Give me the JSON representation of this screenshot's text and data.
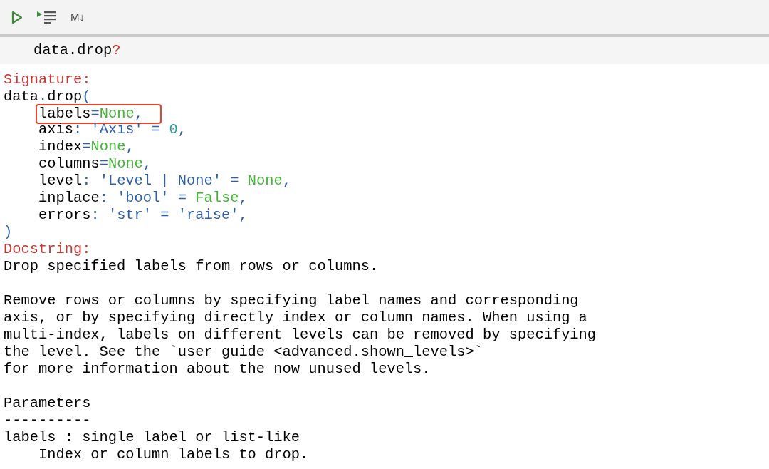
{
  "toolbar": [
    {
      "kind": "run"
    },
    {
      "kind": "run-all"
    },
    {
      "kind": "markdown",
      "label": "M↓"
    }
  ],
  "input": {
    "code": "data.drop",
    "suffix": "?"
  },
  "output": {
    "signature_heading": "Signature:",
    "signature": [
      {
        "indent": false,
        "highlighted": false,
        "tokens": [
          {
            "t": "data",
            "kind": "name"
          },
          {
            "t": ".",
            "kind": "op"
          },
          {
            "t": "drop",
            "kind": "name"
          },
          {
            "t": "(",
            "kind": "op"
          }
        ]
      },
      {
        "indent": true,
        "highlighted": true,
        "tokens": [
          {
            "t": "labels",
            "kind": "name"
          },
          {
            "t": "=",
            "kind": "op"
          },
          {
            "t": "None",
            "kind": "const"
          },
          {
            "t": ",",
            "kind": "op"
          }
        ]
      },
      {
        "indent": true,
        "highlighted": false,
        "tokens": [
          {
            "t": "axis",
            "kind": "name"
          },
          {
            "t": ": 'Axis' = ",
            "kind": "op"
          },
          {
            "t": "0",
            "kind": "num"
          },
          {
            "t": ",",
            "kind": "op"
          }
        ]
      },
      {
        "indent": true,
        "highlighted": false,
        "tokens": [
          {
            "t": "index",
            "kind": "name"
          },
          {
            "t": "=",
            "kind": "op"
          },
          {
            "t": "None",
            "kind": "const"
          },
          {
            "t": ",",
            "kind": "op"
          }
        ]
      },
      {
        "indent": true,
        "highlighted": false,
        "tokens": [
          {
            "t": "columns",
            "kind": "name"
          },
          {
            "t": "=",
            "kind": "op"
          },
          {
            "t": "None",
            "kind": "const"
          },
          {
            "t": ",",
            "kind": "op"
          }
        ]
      },
      {
        "indent": true,
        "highlighted": false,
        "tokens": [
          {
            "t": "level",
            "kind": "name"
          },
          {
            "t": ": 'Level | None' = ",
            "kind": "op"
          },
          {
            "t": "None",
            "kind": "const"
          },
          {
            "t": ",",
            "kind": "op"
          }
        ]
      },
      {
        "indent": true,
        "highlighted": false,
        "tokens": [
          {
            "t": "inplace",
            "kind": "name"
          },
          {
            "t": ": 'bool' = ",
            "kind": "op"
          },
          {
            "t": "False",
            "kind": "const"
          },
          {
            "t": ",",
            "kind": "op"
          }
        ]
      },
      {
        "indent": true,
        "highlighted": false,
        "tokens": [
          {
            "t": "errors",
            "kind": "name"
          },
          {
            "t": ": 'str' = 'raise',",
            "kind": "op"
          }
        ]
      },
      {
        "indent": false,
        "highlighted": false,
        "tokens": [
          {
            "t": ")",
            "kind": "op"
          }
        ]
      }
    ],
    "docstring_heading": "Docstring:",
    "paragraphs": [
      [
        "Drop specified labels from rows or columns."
      ],
      [
        "Remove rows or columns by specifying label names and corresponding",
        "axis, or by specifying directly index or column names. When using a",
        "multi-index, labels on different levels can be removed by specifying",
        "the level. See the `user guide <advanced.shown_levels>`",
        "for more information about the now unused levels."
      ],
      [
        "Parameters",
        "----------",
        "labels : single label or list-like",
        "    Index or column labels to drop."
      ]
    ]
  }
}
